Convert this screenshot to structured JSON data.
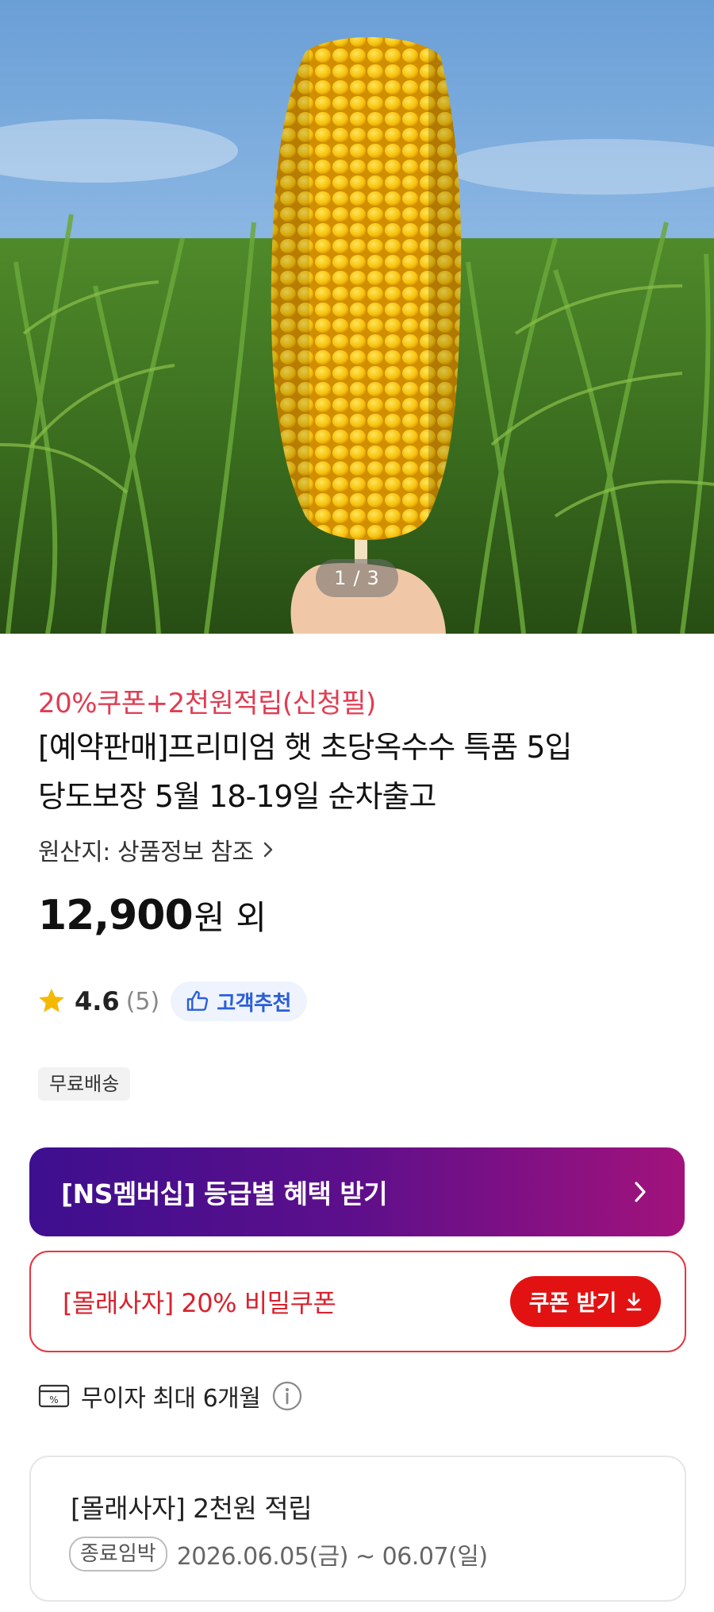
{
  "hero": {
    "image_alt": "corn",
    "pager": {
      "current": "1",
      "separator": "/",
      "total": "3"
    }
  },
  "product": {
    "promo": "20%쿠폰+2천원적립(신청필)",
    "title_line1": "[예약판매]프리미엄 햇 초당옥수수 특품 5입",
    "title_line2": "당도보장 5월 18-19일 순차출고",
    "origin": "원산지: 상품정보 참조",
    "price": "12,900",
    "price_unit": "원",
    "price_suffix": "외",
    "rating": "4.6",
    "review_count": "(5)",
    "recommend_label": "고객추천",
    "shipping_tag": "무료배송"
  },
  "membership": {
    "label": "[NS멤버십] 등급별 혜택 받기"
  },
  "coupon": {
    "label": "[몰래사자] 20% 비밀쿠폰",
    "button": "쿠폰 받기"
  },
  "installment": {
    "label": "무이자 최대 6개월"
  },
  "reward": {
    "title": "[몰래사자] 2천원 적립",
    "badge": "종료임박",
    "period": "2026.06.05(금) ~ 06.07(일)"
  },
  "colors": {
    "promo_red": "#e03d52",
    "membership_gradient_start": "#3d0f8f",
    "membership_gradient_end": "#a2127c",
    "coupon_red": "#e21212",
    "recommend_blue": "#2b5fd9",
    "star_yellow": "#f5b800"
  },
  "icons": [
    "star-icon",
    "thumbs-up-icon",
    "chevron-right-icon",
    "download-icon",
    "card-percent-icon",
    "info-icon"
  ]
}
